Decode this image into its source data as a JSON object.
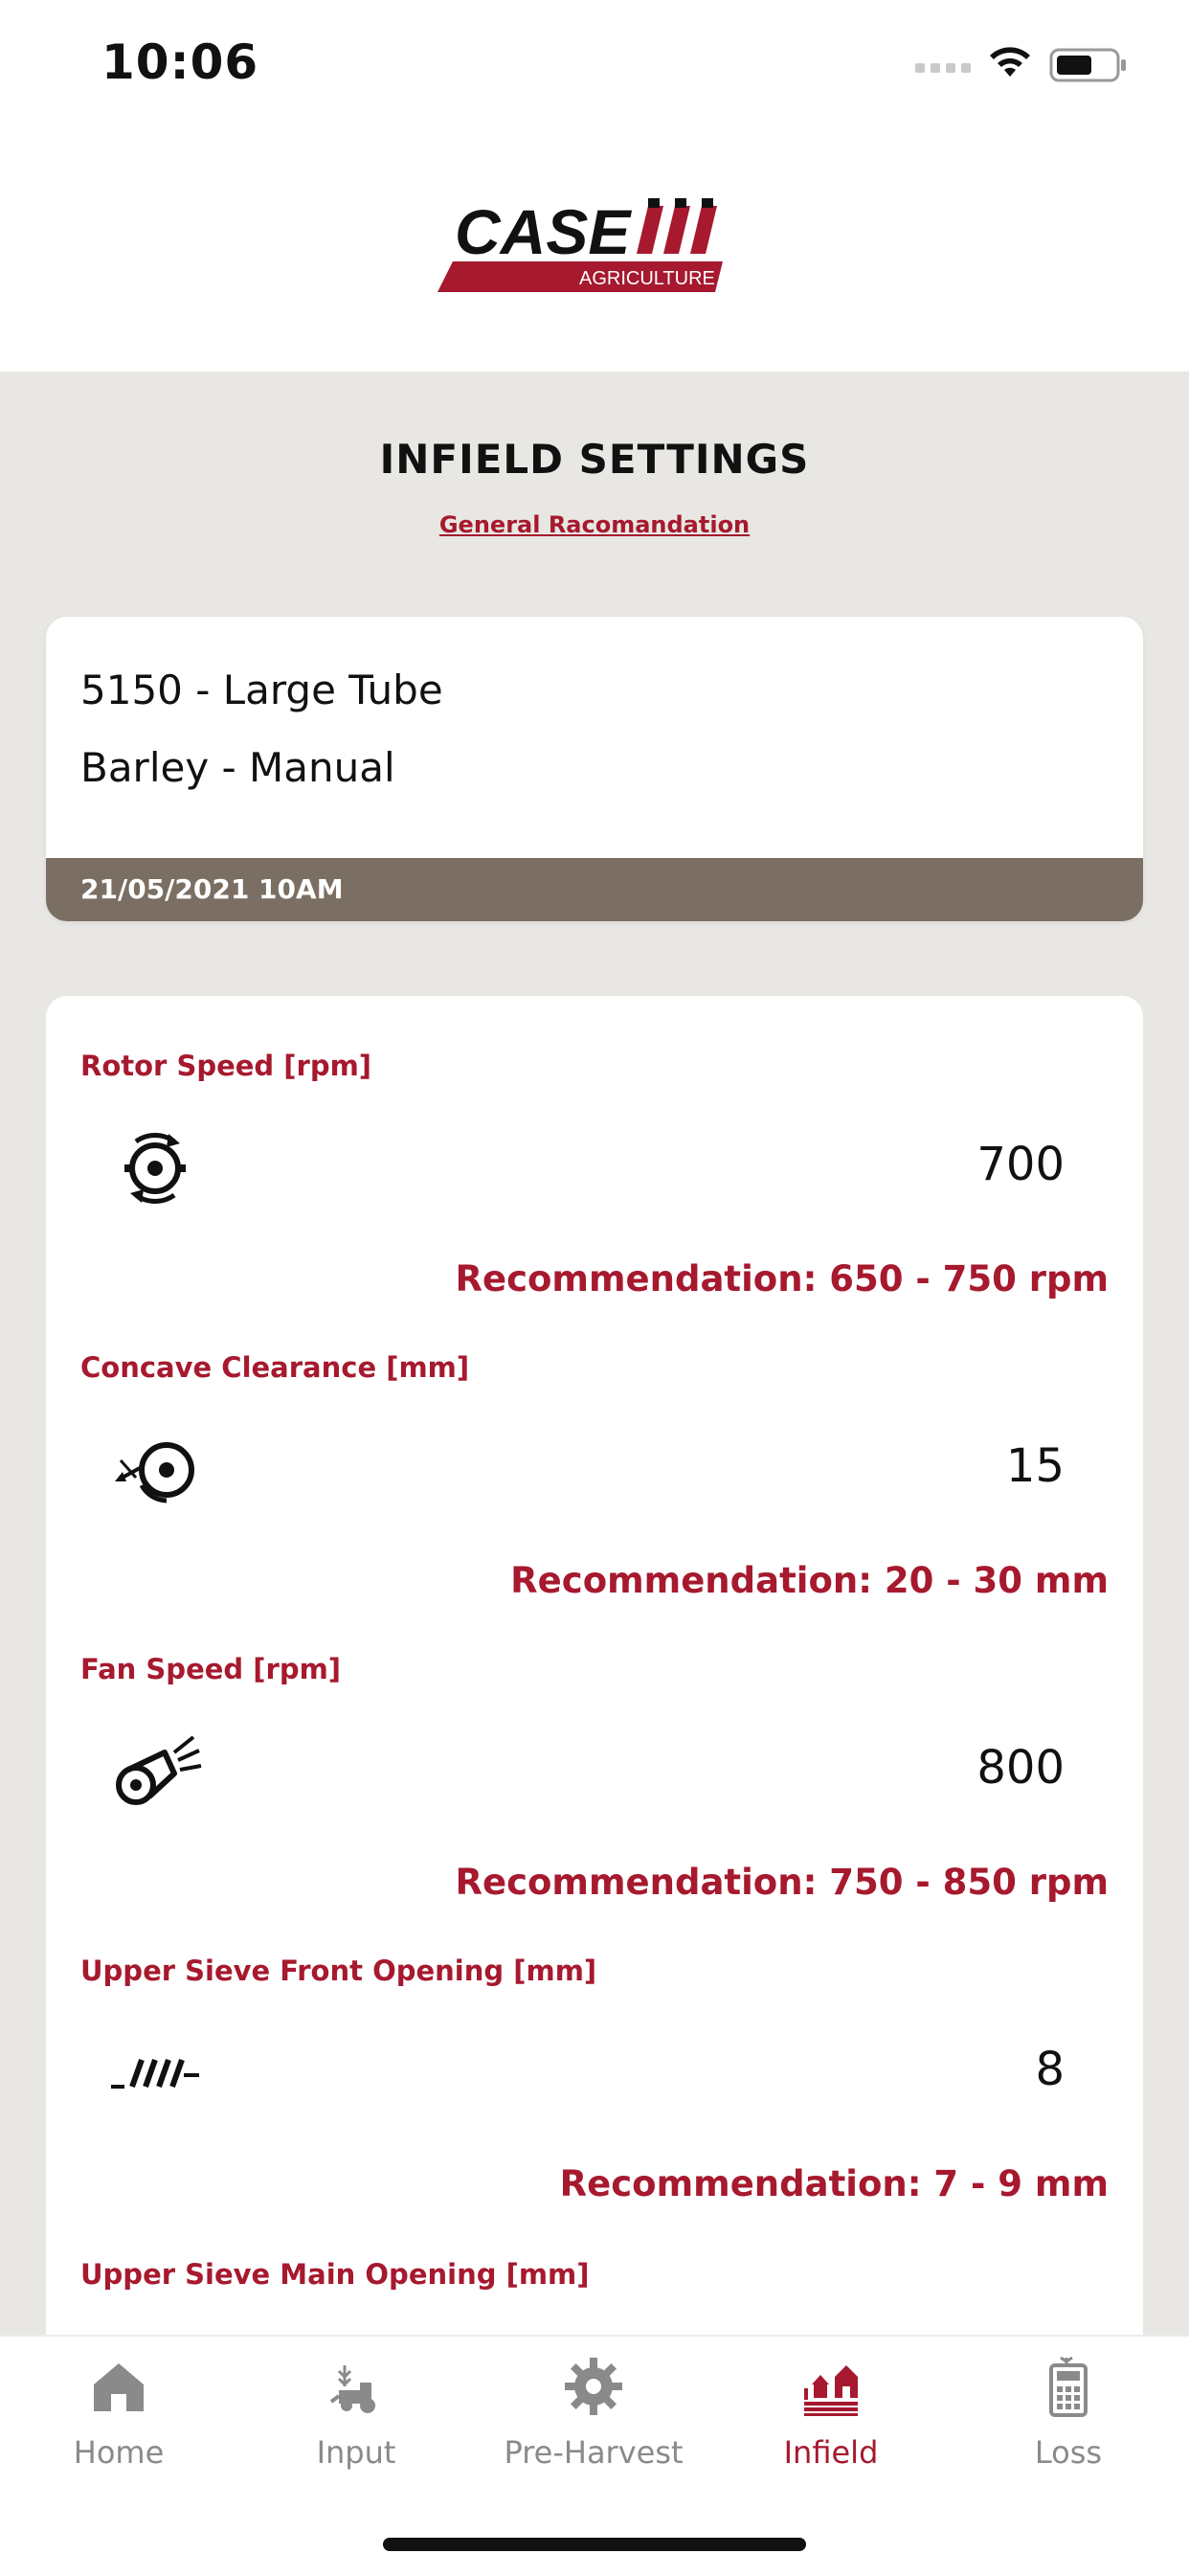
{
  "status": {
    "time": "10:06"
  },
  "header": {
    "logo_text": "CASE",
    "logo_sub": "AGRICULTURE"
  },
  "page": {
    "title": "INFIELD SETTINGS",
    "link": "General Racomandation"
  },
  "info": {
    "line1": "5150 - Large Tube",
    "line2": "Barley - Manual",
    "date": "21/05/2021 10AM"
  },
  "settings": [
    {
      "label": "Rotor Speed [rpm]",
      "icon": "rotor-icon",
      "value": "700",
      "recommendation": "Recommendation: 650 - 750 rpm"
    },
    {
      "label": "Concave Clearance [mm]",
      "icon": "concave-icon",
      "value": "15",
      "recommendation": "Recommendation: 20 - 30 mm"
    },
    {
      "label": "Fan Speed [rpm]",
      "icon": "fan-icon",
      "value": "800",
      "recommendation": "Recommendation: 750 - 850 rpm"
    },
    {
      "label": "Upper Sieve Front Opening [mm]",
      "icon": "sieve-icon",
      "value": "8",
      "recommendation": "Recommendation: 7 - 9 mm"
    }
  ],
  "next_setting_label": "Upper Sieve Main Opening [mm]",
  "tabs": [
    {
      "label": "Home",
      "icon": "home-icon"
    },
    {
      "label": "Input",
      "icon": "harvester-icon"
    },
    {
      "label": "Pre-Harvest",
      "icon": "gear-icon"
    },
    {
      "label": "Infield",
      "icon": "field-icon",
      "active": true
    },
    {
      "label": "Loss",
      "icon": "calculator-icon"
    }
  ],
  "colors": {
    "accent": "#a6192e",
    "date_bar": "#7b6e62",
    "background": "#e8e7e3"
  }
}
